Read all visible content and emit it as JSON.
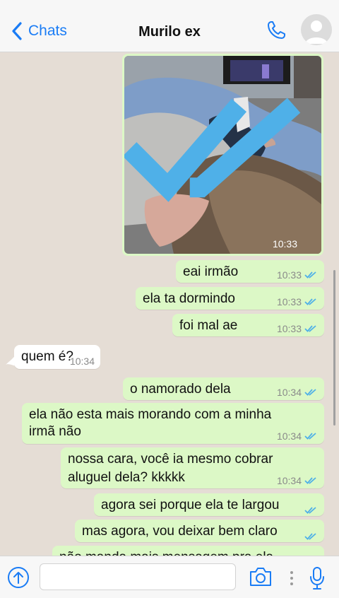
{
  "header": {
    "back_label": "Chats",
    "contact_name": "Murilo ex"
  },
  "photo": {
    "time": "10:33"
  },
  "messages": [
    {
      "text": "eai irmão",
      "time": "10:33",
      "direction": "out",
      "status": "read"
    },
    {
      "text": "ela ta dormindo",
      "time": "10:33",
      "direction": "out",
      "status": "read"
    },
    {
      "text": "foi mal ae",
      "time": "10:33",
      "direction": "out",
      "status": "read"
    },
    {
      "text": "quem é?",
      "time": "10:34",
      "direction": "in"
    },
    {
      "text": "o namorado dela",
      "time": "10:34",
      "direction": "out",
      "status": "read"
    },
    {
      "line1": "ela não esta mais morando com a minha",
      "line2": "irmã não",
      "time": "10:34",
      "direction": "out",
      "status": "read"
    },
    {
      "line1": "nossa cara, você ia mesmo cobrar",
      "line2": "aluguel dela? kkkkk",
      "time": "10:34",
      "direction": "out",
      "status": "read"
    },
    {
      "text": "agora sei porque ela te largou",
      "direction": "out",
      "status": "read"
    },
    {
      "text": "mas agora, vou deixar bem claro",
      "direction": "out",
      "status": "read"
    },
    {
      "text": "não manda mais mensagem pra ela",
      "direction": "out"
    }
  ],
  "composer": {
    "value": ""
  },
  "colors": {
    "accent": "#1a7cf5",
    "outgoing": "#dcf8c6",
    "incoming": "#ffffff",
    "background": "#e5ddd5",
    "read_ticks": "#4fb0e8"
  },
  "icons": [
    "chevron-left-icon",
    "phone-icon",
    "avatar-icon",
    "double-check-icon",
    "arrow-up-icon",
    "camera-icon",
    "microphone-icon"
  ]
}
